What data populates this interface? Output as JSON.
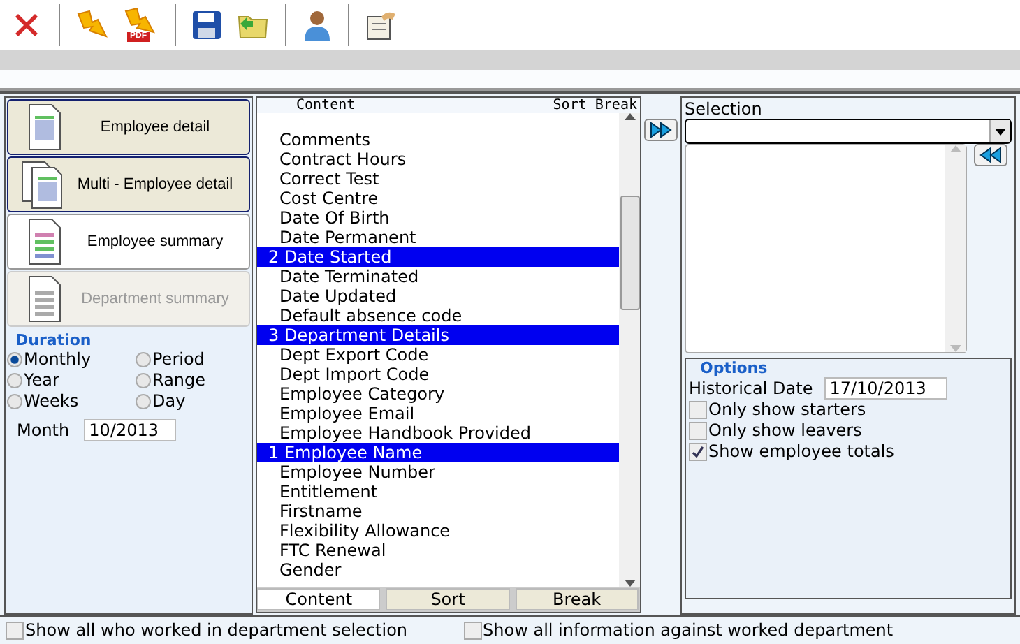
{
  "toolbar": [
    {
      "kind": "delete"
    },
    {
      "kind": "export"
    },
    {
      "kind": "pdf",
      "badge": "PDF"
    },
    {
      "kind": "save"
    },
    {
      "kind": "folder"
    },
    {
      "kind": "user"
    },
    {
      "kind": "notes"
    }
  ],
  "reports": [
    {
      "label": "Employee detail",
      "kind": "single",
      "selected": true,
      "disabled": false
    },
    {
      "label": "Multi - Employee detail",
      "kind": "multi",
      "selected": true,
      "disabled": false
    },
    {
      "label": "Employee summary",
      "kind": "summary",
      "selected": false,
      "disabled": false
    },
    {
      "label": "Department summary",
      "kind": "summary",
      "selected": false,
      "disabled": true
    }
  ],
  "duration": {
    "title": "Duration",
    "options": [
      {
        "label": "Monthly",
        "selected": true
      },
      {
        "label": "Period",
        "selected": false
      },
      {
        "label": "Year",
        "selected": false
      },
      {
        "label": "Range",
        "selected": false
      },
      {
        "label": "Weeks",
        "selected": false
      },
      {
        "label": "Day",
        "selected": false
      }
    ],
    "month_label": "Month",
    "month_value": "10/2013"
  },
  "content_list": {
    "header_content": "Content",
    "header_sort_break": "Sort Break",
    "items": [
      {
        "label": "Comments",
        "selected": false
      },
      {
        "label": "Contract Hours",
        "selected": false
      },
      {
        "label": "Correct Test",
        "selected": false
      },
      {
        "label": "Cost Centre",
        "selected": false
      },
      {
        "label": "Date Of Birth",
        "selected": false
      },
      {
        "label": "Date Permanent",
        "selected": false
      },
      {
        "label": "Date Started",
        "selected": true,
        "order": "2"
      },
      {
        "label": "Date Terminated",
        "selected": false
      },
      {
        "label": "Date Updated",
        "selected": false
      },
      {
        "label": "Default absence code",
        "selected": false
      },
      {
        "label": "Department Details",
        "selected": true,
        "order": "3"
      },
      {
        "label": "Dept Export Code",
        "selected": false
      },
      {
        "label": "Dept Import Code",
        "selected": false
      },
      {
        "label": "Employee Category",
        "selected": false
      },
      {
        "label": "Employee Email",
        "selected": false
      },
      {
        "label": "Employee Handbook Provided",
        "selected": false
      },
      {
        "label": "Employee Name",
        "selected": true,
        "order": "1"
      },
      {
        "label": "Employee Number",
        "selected": false
      },
      {
        "label": "Entitlement",
        "selected": false
      },
      {
        "label": "Firstname",
        "selected": false
      },
      {
        "label": "Flexibility Allowance",
        "selected": false
      },
      {
        "label": "FTC Renewal",
        "selected": false
      },
      {
        "label": "Gender",
        "selected": false
      }
    ],
    "tabs": [
      {
        "label": "Content",
        "selected": true
      },
      {
        "label": "Sort",
        "selected": false
      },
      {
        "label": "Break",
        "selected": false
      }
    ]
  },
  "selection": {
    "title": "Selection"
  },
  "options": {
    "title": "Options",
    "historical_date_label": "Historical Date",
    "historical_date": "17/10/2013",
    "checks": [
      {
        "label": "Only show starters",
        "checked": false
      },
      {
        "label": "Only show leavers",
        "checked": false
      },
      {
        "label": "Show employee totals",
        "checked": true
      }
    ]
  },
  "footer": [
    {
      "label": "Show all who worked in department selection",
      "checked": false
    },
    {
      "label": "Show all information against worked department",
      "checked": false
    }
  ]
}
